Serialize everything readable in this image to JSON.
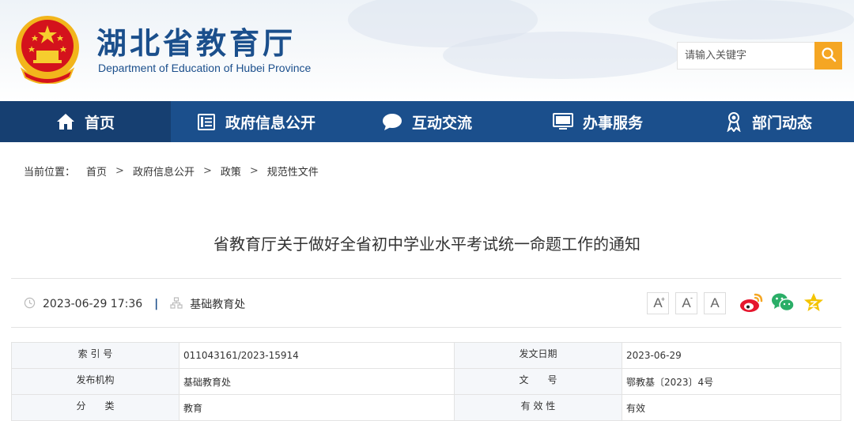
{
  "header": {
    "title": "湖北省教育厅",
    "subtitle": "Department of Education of Hubei Province",
    "search_placeholder": "请输入关键字"
  },
  "nav": {
    "items": [
      {
        "label": "首页",
        "icon": "home-icon"
      },
      {
        "label": "政府信息公开",
        "icon": "document-list-icon"
      },
      {
        "label": "互动交流",
        "icon": "chat-bubble-icon"
      },
      {
        "label": "办事服务",
        "icon": "monitor-icon"
      },
      {
        "label": "部门动态",
        "icon": "award-icon"
      }
    ]
  },
  "breadcrumb": {
    "lead": "当前位置：",
    "items": [
      "首页",
      "政府信息公开",
      "政策",
      "规范性文件"
    ],
    "separator": ">"
  },
  "article": {
    "title": "省教育厅关于做好全省初中学业水平考试统一命题工作的通知",
    "datetime": "2023-06-29 17:36",
    "meta_separator": "|",
    "department": "基础教育处",
    "font_buttons": [
      "A",
      "A",
      "A"
    ]
  },
  "info_table": {
    "rows": [
      {
        "label1": "索 引 号",
        "value1": "011043161/2023-15914",
        "label2": "发文日期",
        "value2": "2023-06-29"
      },
      {
        "label1": "发布机构",
        "value1": "基础教育处",
        "label2": "文　　号",
        "value2": "鄂教基〔2023〕4号"
      },
      {
        "label1": "分　　类",
        "value1": "教育",
        "label2": "有 效 性",
        "value2": "有效"
      }
    ]
  },
  "colors": {
    "brand_blue": "#1b4f8c",
    "nav_active": "#163f71",
    "search_button": "#f5a623",
    "weibo": "#e6162d",
    "wechat": "#2aae67",
    "favorite": "#f4c400"
  }
}
